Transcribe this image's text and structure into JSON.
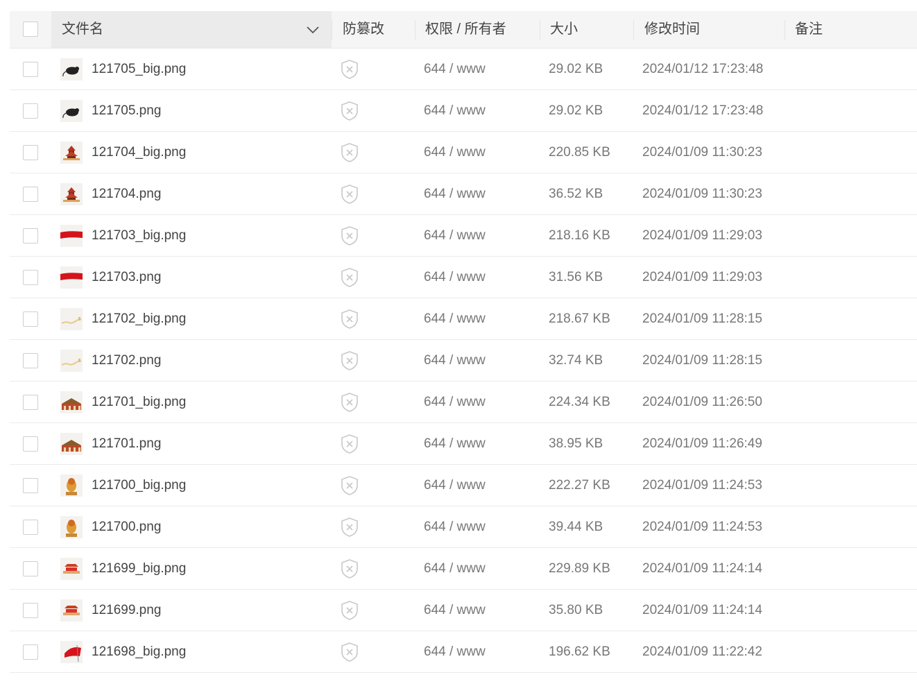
{
  "header": {
    "name": "文件名",
    "tamper": "防篡改",
    "perm": "权限 / 所有者",
    "size": "大小",
    "mtime": "修改时间",
    "note": "备注"
  },
  "colors": {
    "header_bg": "#f5f5f5",
    "sorted_col_bg": "#ebebeb",
    "shield_gray": "#c8c8c8",
    "row_border": "#ebebeb"
  },
  "rows": [
    {
      "name": "121705_big.png",
      "perm": "644 / www",
      "size": "29.02 KB",
      "mtime": "2024/01/12 17:23:48",
      "thumb": "rat-black-icon"
    },
    {
      "name": "121705.png",
      "perm": "644 / www",
      "size": "29.02 KB",
      "mtime": "2024/01/12 17:23:48",
      "thumb": "rat-black-icon"
    },
    {
      "name": "121704_big.png",
      "perm": "644 / www",
      "size": "220.85 KB",
      "mtime": "2024/01/09 11:30:23",
      "thumb": "temple-icon"
    },
    {
      "name": "121704.png",
      "perm": "644 / www",
      "size": "36.52 KB",
      "mtime": "2024/01/09 11:30:23",
      "thumb": "temple-icon"
    },
    {
      "name": "121703_big.png",
      "perm": "644 / www",
      "size": "218.16 KB",
      "mtime": "2024/01/09 11:29:03",
      "thumb": "red-flag-icon"
    },
    {
      "name": "121703.png",
      "perm": "644 / www",
      "size": "31.56 KB",
      "mtime": "2024/01/09 11:29:03",
      "thumb": "red-flag-icon"
    },
    {
      "name": "121702_big.png",
      "perm": "644 / www",
      "size": "218.67 KB",
      "mtime": "2024/01/09 11:28:15",
      "thumb": "great-wall-icon"
    },
    {
      "name": "121702.png",
      "perm": "644 / www",
      "size": "32.74 KB",
      "mtime": "2024/01/09 11:28:15",
      "thumb": "great-wall-icon"
    },
    {
      "name": "121701_big.png",
      "perm": "644 / www",
      "size": "224.34 KB",
      "mtime": "2024/01/09 11:26:50",
      "thumb": "palace-icon"
    },
    {
      "name": "121701.png",
      "perm": "644 / www",
      "size": "38.95 KB",
      "mtime": "2024/01/09 11:26:49",
      "thumb": "palace-icon"
    },
    {
      "name": "121700_big.png",
      "perm": "644 / www",
      "size": "222.27 KB",
      "mtime": "2024/01/09 11:24:53",
      "thumb": "lion-statue-icon"
    },
    {
      "name": "121700.png",
      "perm": "644 / www",
      "size": "39.44 KB",
      "mtime": "2024/01/09 11:24:53",
      "thumb": "lion-statue-icon"
    },
    {
      "name": "121699_big.png",
      "perm": "644 / www",
      "size": "229.89 KB",
      "mtime": "2024/01/09 11:24:14",
      "thumb": "gate-tower-icon"
    },
    {
      "name": "121699.png",
      "perm": "644 / www",
      "size": "35.80 KB",
      "mtime": "2024/01/09 11:24:14",
      "thumb": "gate-tower-icon"
    },
    {
      "name": "121698_big.png",
      "perm": "644 / www",
      "size": "196.62 KB",
      "mtime": "2024/01/09 11:22:42",
      "thumb": "flag-wave-icon"
    }
  ]
}
